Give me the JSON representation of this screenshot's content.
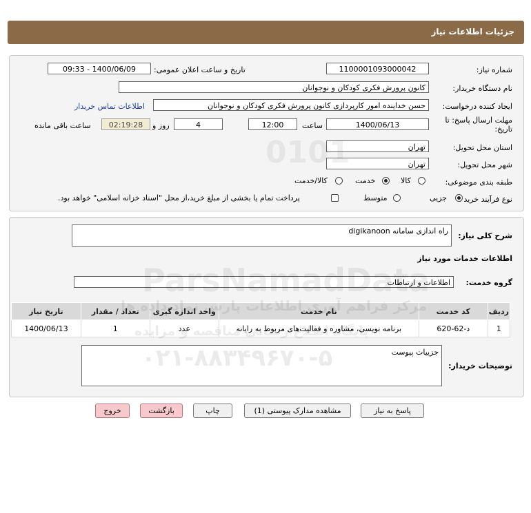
{
  "header": {
    "title": "جزئیات اطلاعات نیاز"
  },
  "form": {
    "need_number_label": "شماره نیاز:",
    "need_number": "1100001093000042",
    "announce_label": "تاریخ و ساعت اعلان عمومی:",
    "announce_value": "1400/06/09 - 09:33",
    "buyer_label": "نام دستگاه خریدار:",
    "buyer_value": "کانون پرورش فکری کودکان و نوجوانان",
    "requester_label": "ایجاد کننده درخواست:",
    "requester_value": "حسن خداینده امور کارپردازی  کانون پرورش فکری کودکان و نوجوانان",
    "contact_link": "اطلاعات تماس خریدار",
    "deadline_label_1": "مهلت ارسال پاسخ: تا",
    "deadline_label_2": "تاریخ:",
    "deadline_date": "1400/06/13",
    "time_label": "ساعت",
    "deadline_time": "12:00",
    "days_value": "4",
    "days_label": "روز و",
    "remaining_time": "02:19:28",
    "remaining_label": "ساعت باقی مانده",
    "province_label": "استان محل تحویل:",
    "province_value": "تهران",
    "city_label": "شهر محل تحویل:",
    "city_value": "تهران",
    "category_label": "طبقه بندی موضوعی:",
    "category_options": [
      "کالا",
      "خدمت",
      "کالا/خدمت"
    ],
    "category_selected": "خدمت",
    "process_label": "نوع فرآیند خرید :",
    "process_options": [
      "جزیی",
      "متوسط"
    ],
    "process_selected": "جزیی",
    "payment_note": "پرداخت تمام یا بخشی از مبلغ خرید،از محل \"اسناد خزانه اسلامی\" خواهد بود."
  },
  "details": {
    "summary_label": "شرح کلی نیاز:",
    "summary_value": "راه اندازی سامانه digikanoon",
    "services_heading": "اطلاعات خدمات مورد نیاز",
    "service_group_label": "گروه خدمت:",
    "service_group_value": "اطلاعات و ارتباطات",
    "table": {
      "headers": [
        "ردیف",
        "کد خدمت",
        "نام خدمت",
        "واحد اندازه گیری",
        "تعداد / مقدار",
        "تاریخ نیاز"
      ],
      "rows": [
        [
          "1",
          "د-62-620",
          "برنامه نویسی، مشاوره و فعالیت‌های مربوط به رایانه",
          "عدد",
          "1",
          "1400/06/13"
        ]
      ]
    },
    "buyer_notes_label": "توضیحات خریدار:",
    "buyer_notes_value": "جزییات پیوست"
  },
  "buttons": {
    "reply": "پاسخ به نیاز",
    "attachments": "مشاهده مدارک پیوستی (1)",
    "print": "چاپ",
    "back": "بازگشت",
    "exit": "خروج"
  },
  "watermark": {
    "brand": "ParsNamadData",
    "line1": "مرکز فراهم آوری اطلاعات پارس نماد داده ها",
    "line2": "پایگاه اطلاع رسانی مناقصه و مزایده",
    "phone": "۰۲۱-۸۸۳۴۹۶۷۰-۵"
  },
  "colors": {
    "header": "#8b6a48",
    "link": "#1a3fa8",
    "exit_button": "#f7c8cc"
  }
}
